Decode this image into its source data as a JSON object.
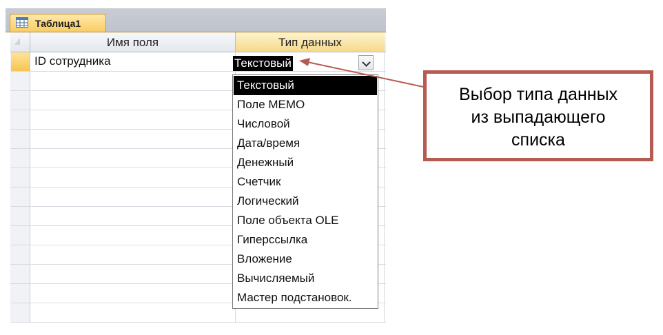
{
  "document_tab": {
    "label": "Таблица1",
    "icon": "table-icon"
  },
  "table_design": {
    "columns": [
      "Имя поля",
      "Тип данных"
    ],
    "rows": [
      {
        "field_name": "ID сотрудника",
        "data_type": "Текстовый"
      }
    ]
  },
  "combo": {
    "value": "Текстовый",
    "arrow_icon": "chevron-down-icon"
  },
  "dropdown": {
    "options": [
      "Текстовый",
      "Поле MEMO",
      "Числовой",
      "Дата/время",
      "Денежный",
      "Счетчик",
      "Логический",
      "Поле объекта OLE",
      "Гиперссылка",
      "Вложение",
      "Вычисляемый",
      "Мастер подстановок."
    ],
    "selected": "Текстовый"
  },
  "callout": {
    "lines": [
      "Выбор типа данных",
      "из выпадающего",
      "списка"
    ],
    "border_color": "#b65b52"
  },
  "colors": {
    "active_header": "#f6d98a",
    "selection": "#000000",
    "tab_bg": "#bfc3cb"
  }
}
